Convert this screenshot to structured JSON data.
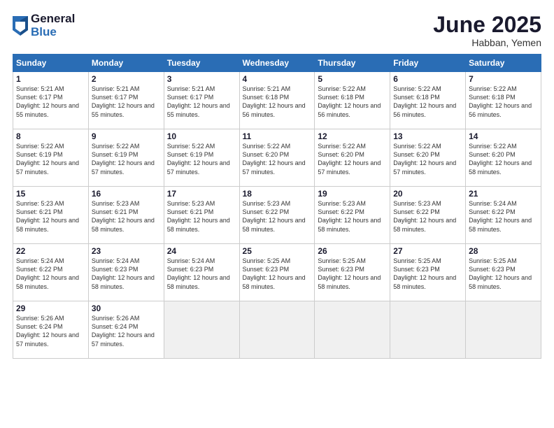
{
  "logo": {
    "general": "General",
    "blue": "Blue"
  },
  "title": "June 2025",
  "location": "Habban, Yemen",
  "days_header": [
    "Sunday",
    "Monday",
    "Tuesday",
    "Wednesday",
    "Thursday",
    "Friday",
    "Saturday"
  ],
  "weeks": [
    [
      {
        "day": "1",
        "sunrise": "5:21 AM",
        "sunset": "6:17 PM",
        "daylight": "12 hours and 55 minutes."
      },
      {
        "day": "2",
        "sunrise": "5:21 AM",
        "sunset": "6:17 PM",
        "daylight": "12 hours and 55 minutes."
      },
      {
        "day": "3",
        "sunrise": "5:21 AM",
        "sunset": "6:17 PM",
        "daylight": "12 hours and 55 minutes."
      },
      {
        "day": "4",
        "sunrise": "5:21 AM",
        "sunset": "6:18 PM",
        "daylight": "12 hours and 56 minutes."
      },
      {
        "day": "5",
        "sunrise": "5:22 AM",
        "sunset": "6:18 PM",
        "daylight": "12 hours and 56 minutes."
      },
      {
        "day": "6",
        "sunrise": "5:22 AM",
        "sunset": "6:18 PM",
        "daylight": "12 hours and 56 minutes."
      },
      {
        "day": "7",
        "sunrise": "5:22 AM",
        "sunset": "6:18 PM",
        "daylight": "12 hours and 56 minutes."
      }
    ],
    [
      {
        "day": "8",
        "sunrise": "5:22 AM",
        "sunset": "6:19 PM",
        "daylight": "12 hours and 57 minutes."
      },
      {
        "day": "9",
        "sunrise": "5:22 AM",
        "sunset": "6:19 PM",
        "daylight": "12 hours and 57 minutes."
      },
      {
        "day": "10",
        "sunrise": "5:22 AM",
        "sunset": "6:19 PM",
        "daylight": "12 hours and 57 minutes."
      },
      {
        "day": "11",
        "sunrise": "5:22 AM",
        "sunset": "6:20 PM",
        "daylight": "12 hours and 57 minutes."
      },
      {
        "day": "12",
        "sunrise": "5:22 AM",
        "sunset": "6:20 PM",
        "daylight": "12 hours and 57 minutes."
      },
      {
        "day": "13",
        "sunrise": "5:22 AM",
        "sunset": "6:20 PM",
        "daylight": "12 hours and 57 minutes."
      },
      {
        "day": "14",
        "sunrise": "5:22 AM",
        "sunset": "6:20 PM",
        "daylight": "12 hours and 58 minutes."
      }
    ],
    [
      {
        "day": "15",
        "sunrise": "5:23 AM",
        "sunset": "6:21 PM",
        "daylight": "12 hours and 58 minutes."
      },
      {
        "day": "16",
        "sunrise": "5:23 AM",
        "sunset": "6:21 PM",
        "daylight": "12 hours and 58 minutes."
      },
      {
        "day": "17",
        "sunrise": "5:23 AM",
        "sunset": "6:21 PM",
        "daylight": "12 hours and 58 minutes."
      },
      {
        "day": "18",
        "sunrise": "5:23 AM",
        "sunset": "6:22 PM",
        "daylight": "12 hours and 58 minutes."
      },
      {
        "day": "19",
        "sunrise": "5:23 AM",
        "sunset": "6:22 PM",
        "daylight": "12 hours and 58 minutes."
      },
      {
        "day": "20",
        "sunrise": "5:23 AM",
        "sunset": "6:22 PM",
        "daylight": "12 hours and 58 minutes."
      },
      {
        "day": "21",
        "sunrise": "5:24 AM",
        "sunset": "6:22 PM",
        "daylight": "12 hours and 58 minutes."
      }
    ],
    [
      {
        "day": "22",
        "sunrise": "5:24 AM",
        "sunset": "6:22 PM",
        "daylight": "12 hours and 58 minutes."
      },
      {
        "day": "23",
        "sunrise": "5:24 AM",
        "sunset": "6:23 PM",
        "daylight": "12 hours and 58 minutes."
      },
      {
        "day": "24",
        "sunrise": "5:24 AM",
        "sunset": "6:23 PM",
        "daylight": "12 hours and 58 minutes."
      },
      {
        "day": "25",
        "sunrise": "5:25 AM",
        "sunset": "6:23 PM",
        "daylight": "12 hours and 58 minutes."
      },
      {
        "day": "26",
        "sunrise": "5:25 AM",
        "sunset": "6:23 PM",
        "daylight": "12 hours and 58 minutes."
      },
      {
        "day": "27",
        "sunrise": "5:25 AM",
        "sunset": "6:23 PM",
        "daylight": "12 hours and 58 minutes."
      },
      {
        "day": "28",
        "sunrise": "5:25 AM",
        "sunset": "6:23 PM",
        "daylight": "12 hours and 58 minutes."
      }
    ],
    [
      {
        "day": "29",
        "sunrise": "5:26 AM",
        "sunset": "6:24 PM",
        "daylight": "12 hours and 57 minutes."
      },
      {
        "day": "30",
        "sunrise": "5:26 AM",
        "sunset": "6:24 PM",
        "daylight": "12 hours and 57 minutes."
      },
      null,
      null,
      null,
      null,
      null
    ]
  ]
}
